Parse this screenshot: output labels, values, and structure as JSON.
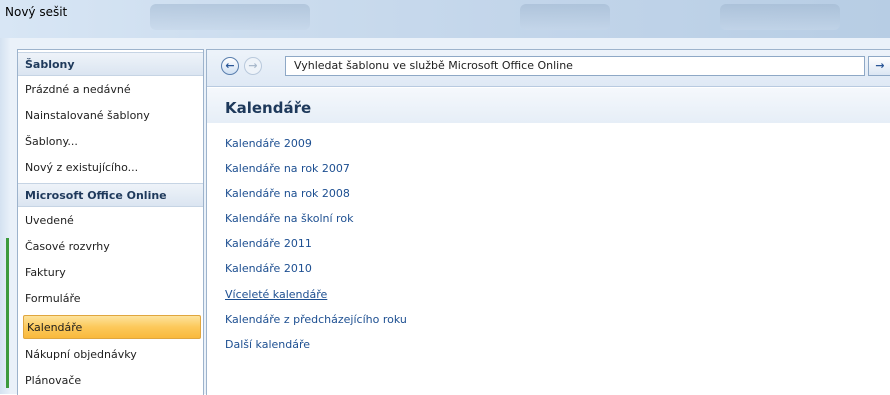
{
  "window": {
    "title": "Nový sešit"
  },
  "sidebar": {
    "items": [
      {
        "label": "Šablony",
        "kind": "header"
      },
      {
        "label": "Prázdné a nedávné",
        "kind": "item"
      },
      {
        "label": "Nainstalované šablony",
        "kind": "item"
      },
      {
        "label": "Šablony...",
        "kind": "item"
      },
      {
        "label": "Nový z existujícího...",
        "kind": "item"
      },
      {
        "label": "Microsoft Office Online",
        "kind": "header"
      },
      {
        "label": "Uvedené",
        "kind": "item"
      },
      {
        "label": "Časové rozvrhy",
        "kind": "item"
      },
      {
        "label": "Faktury",
        "kind": "item"
      },
      {
        "label": "Formuláře",
        "kind": "item"
      },
      {
        "label": "Kalendáře",
        "kind": "selected"
      },
      {
        "label": "Nákupní objednávky",
        "kind": "item"
      },
      {
        "label": "Plánovače",
        "kind": "item"
      }
    ]
  },
  "toolbar": {
    "back_icon": "back-arrow-icon",
    "forward_icon": "forward-arrow-icon",
    "back_glyph": "←",
    "forward_glyph": "→",
    "search_placeholder": "Vyhledat šablonu ve službě Microsoft Office Online",
    "go_glyph": "→"
  },
  "main": {
    "heading": "Kalendáře",
    "links": [
      {
        "label": "Kalendáře 2009",
        "underlined": false
      },
      {
        "label": "Kalendáře na rok 2007",
        "underlined": false
      },
      {
        "label": "Kalendáře na rok 2008",
        "underlined": false
      },
      {
        "label": "Kalendáře na školní rok",
        "underlined": false
      },
      {
        "label": "Kalendáře 2011",
        "underlined": false
      },
      {
        "label": "Kalendáře 2010",
        "underlined": false
      },
      {
        "label": "Víceleté kalendáře",
        "underlined": true
      },
      {
        "label": "Kalendáře z předcházejícího roku",
        "underlined": false
      },
      {
        "label": "Další kalendáře",
        "underlined": false
      }
    ]
  },
  "colors": {
    "accent_selected": "#fcc95b",
    "link": "#1d4f91",
    "heading": "#1e395b"
  }
}
